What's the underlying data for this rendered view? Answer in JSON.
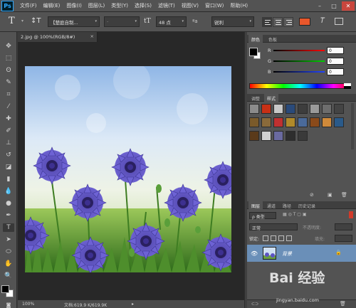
{
  "menubar": {
    "logo": "Ps",
    "items": [
      "文件(F)",
      "编辑(E)",
      "图像(I)",
      "图层(L)",
      "类型(Y)",
      "选择(S)",
      "滤镜(T)",
      "视图(V)",
      "窗口(W)",
      "帮助(H)"
    ],
    "controls": [
      "–",
      "□",
      "✕"
    ]
  },
  "options": {
    "tool_glyph": "T",
    "orient_glyph": "↕T",
    "font_family": "【楚庭自制...",
    "font_style": "-",
    "size_icon": "tT",
    "font_size": "48 点",
    "aa_label": "ªa",
    "aa_method": "锐利",
    "text_color": "#e9572b"
  },
  "document": {
    "tab_title": "2.jpg @ 100%(RGB/8#)",
    "tab_close": "×"
  },
  "status": {
    "zoom": "100%",
    "doc_info": "文档:619.9 K/619.9K",
    "arrow": "▸"
  },
  "color_panel": {
    "tabs": [
      "颜色",
      "色板"
    ],
    "channels": [
      {
        "label": "R",
        "value": "0",
        "color": "#e23c3c"
      },
      {
        "label": "G",
        "value": "0",
        "color": "#29c729"
      },
      {
        "label": "B",
        "value": "0",
        "color": "#3a5ee6"
      }
    ]
  },
  "styles_panel": {
    "tabs": [
      "调整",
      "样式"
    ],
    "swatch_colors": [
      "#8b8b8b",
      "#c83015",
      "#c8c8c8",
      "#2a4a7a",
      "#3d3d3d",
      "#9a9a9a",
      "#6d6d6d",
      "#444444",
      "#7a5a2a",
      "#8a6a3a",
      "#c03030",
      "#b08a2a",
      "#4a6a9a",
      "#8a4a1a",
      "#d08a3a",
      "#2a5a8a",
      "#5a3a1a",
      "#d0d0d0",
      "#6a6aa0",
      "#2e2e2e",
      "#3a3a3a"
    ]
  },
  "layers_panel": {
    "tabs": [
      "图层",
      "通道",
      "路径",
      "历史记录"
    ],
    "filter_label": "ρ 类型",
    "blend_mode": "正常",
    "opacity_label": "不透明度:",
    "lock_label": "锁定:",
    "fill_label": "填充:",
    "layer_name": "背景",
    "eye": "👁"
  },
  "watermark": {
    "logo": "Bai 经验",
    "url": "jingyan.baidu.com"
  }
}
